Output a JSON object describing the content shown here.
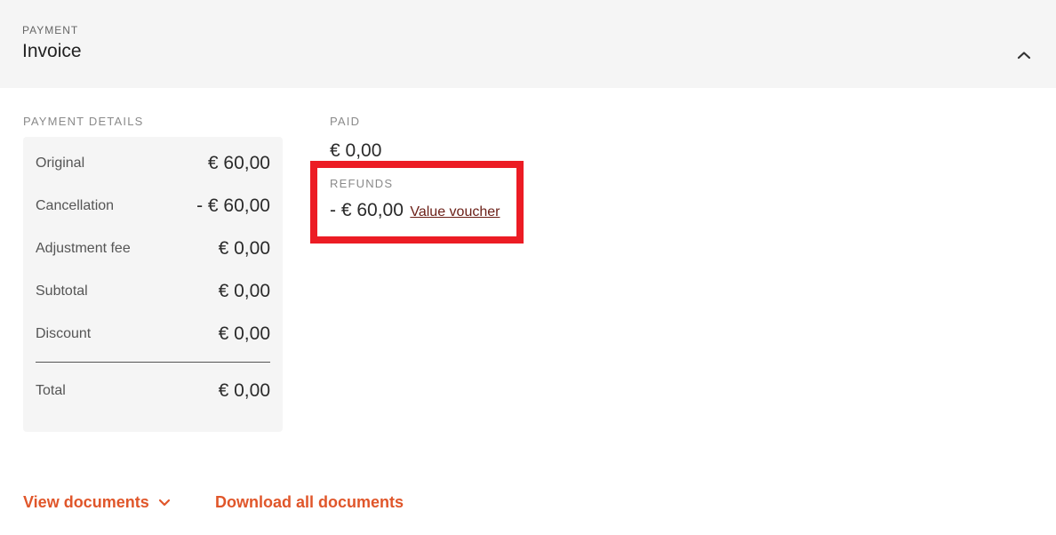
{
  "header": {
    "eyebrow": "PAYMENT",
    "title": "Invoice",
    "collapse_icon": "chevron-up-icon"
  },
  "payment_details": {
    "label": "PAYMENT DETAILS",
    "rows": [
      {
        "label": "Original",
        "value": "€ 60,00"
      },
      {
        "label": "Cancellation",
        "value": "- € 60,00"
      },
      {
        "label": "Adjustment fee",
        "value": "€ 0,00"
      },
      {
        "label": "Subtotal",
        "value": "€ 0,00"
      },
      {
        "label": "Discount",
        "value": "€ 0,00"
      }
    ],
    "total": {
      "label": "Total",
      "value": "€ 0,00"
    }
  },
  "paid": {
    "label": "PAID",
    "value": "€ 0,00"
  },
  "refunds": {
    "label": "REFUNDS",
    "amount": "- € 60,00",
    "method": "Value voucher",
    "highlight_color": "#ec1c24"
  },
  "footer": {
    "view_documents": "View documents",
    "view_documents_icon": "chevron-down-icon",
    "download_all": "Download all documents",
    "accent_color": "#e0562a"
  }
}
